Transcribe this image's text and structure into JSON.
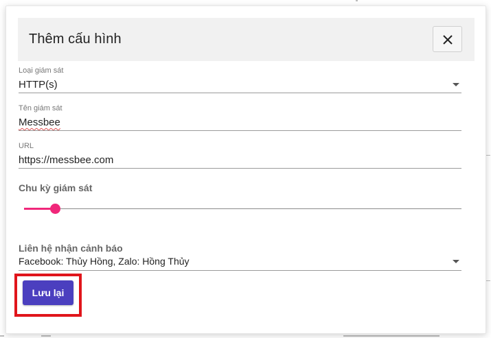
{
  "dialog": {
    "title": "Thêm cấu hình",
    "close_icon": "close-icon"
  },
  "form": {
    "monitor_type": {
      "label": "Loại giám sát",
      "value": "HTTP(s)"
    },
    "monitor_name": {
      "label": "Tên giám sát",
      "value": "Messbee"
    },
    "url": {
      "label": "URL",
      "value": "https://messbee.com"
    },
    "interval": {
      "label": "Chu kỳ giám sát",
      "slider_level": 0.07
    },
    "alert_contacts": {
      "label": "Liên hệ nhận cảnh báo",
      "value": "Facebook: Thủy Hồng, Zalo: Hồng Thủy"
    }
  },
  "actions": {
    "save_label": "Lưu lại"
  },
  "colors": {
    "accent": "#f0277a",
    "primary_button": "#4b3fbf",
    "highlight": "#e0151b"
  }
}
